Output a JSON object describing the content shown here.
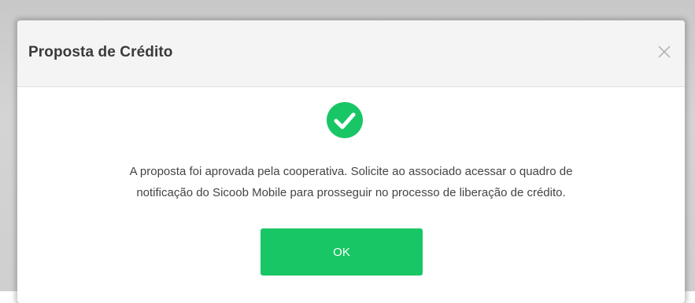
{
  "dialog": {
    "title": "Proposta de Crédito",
    "close_icon": "close-icon",
    "success_icon": "check-circle-icon",
    "message_line1": "A proposta foi aprovada pela cooperativa. Solicite ao associado acessar o quadro de",
    "message_line2": "notificação do Sicoob Mobile para prosseguir no processo de liberação de crédito.",
    "ok_label": "OK"
  },
  "colors": {
    "accent_green": "#19c665",
    "header_bg": "#f4f4f4",
    "text": "#444444"
  }
}
